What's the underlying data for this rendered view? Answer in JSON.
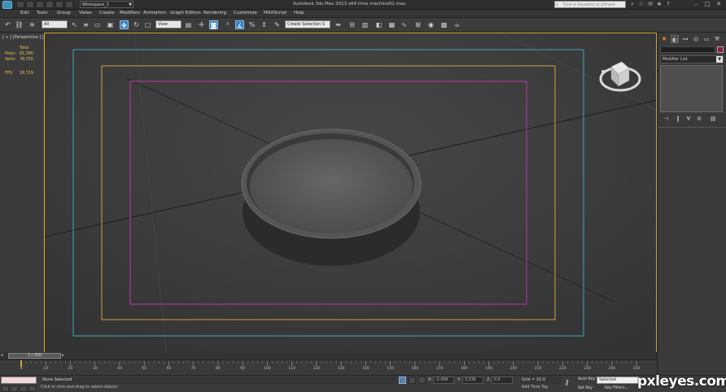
{
  "titlebar": {
    "workspace": "Workspace_1",
    "title": "Autodesk 3ds Max  2013 x64      time machine02.max",
    "search_placeholder": "Type a keyword or phrase"
  },
  "menu": {
    "items": [
      "Edit",
      "Tools",
      "Group",
      "Views",
      "Create",
      "Modifiers",
      "Animation",
      "Graph Editors",
      "Rendering",
      "Customize",
      "MAXScript",
      "Help"
    ]
  },
  "toolbar": {
    "filter_value": "All",
    "ref_coord_value": "View",
    "named_selection_placeholder": "Create Selection S"
  },
  "viewport": {
    "label": "[ + ] [Perspective ] [Realistic ]",
    "stats": {
      "total_label": "Total",
      "polys_label": "Polys:",
      "polys_value": "81,366",
      "verts_label": "Verts:",
      "verts_value": "78,750",
      "fps_label": "FPS:",
      "fps_value": "18.729"
    }
  },
  "command_panel": {
    "modifier_list_label": "Modifier List",
    "color_swatch": "#8c1a3a"
  },
  "timeline": {
    "frame_indicator": "1 / 250",
    "ticks": [
      "0",
      "10",
      "20",
      "30",
      "40",
      "50",
      "60",
      "70",
      "80",
      "90",
      "100",
      "110",
      "120",
      "130",
      "140",
      "150",
      "160",
      "170",
      "180",
      "190",
      "200",
      "210",
      "220",
      "230",
      "240",
      "250"
    ]
  },
  "status": {
    "selection": "None Selected",
    "prompt": "Click or click-and-drag to select objects",
    "x_label": "X:",
    "x_value": "-2.456",
    "y_label": "Y:",
    "y_value": "3.236",
    "z_label": "Z:",
    "z_value": "0.0",
    "grid": "Grid = 10.0",
    "add_time_tag": "Add Time Tag",
    "auto_key": "Auto Key",
    "set_key": "Set Key",
    "selected_value": "Selected",
    "key_filters": "Key Filters..."
  },
  "watermark": "pxleyes.com"
}
